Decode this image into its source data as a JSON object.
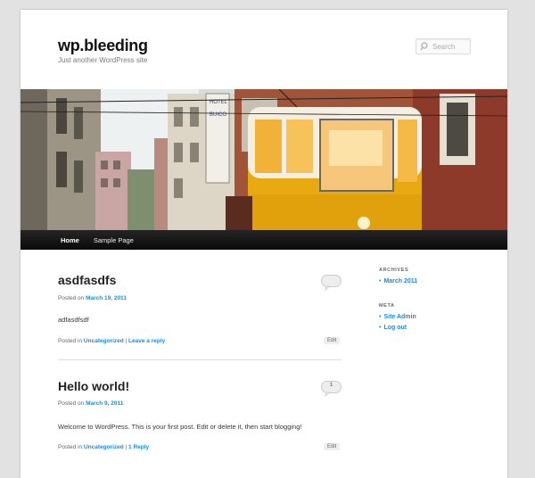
{
  "site": {
    "title": "wp.bleeding",
    "description": "Just another WordPress site"
  },
  "search": {
    "placeholder": "Search",
    "icon": "search-icon"
  },
  "nav": {
    "items": [
      {
        "label": "Home",
        "current": true
      },
      {
        "label": "Sample Page",
        "current": false
      }
    ]
  },
  "posts": [
    {
      "title": "asdfasdfs",
      "posted_on_prefix": "Posted on",
      "date": "March 19, 2011",
      "content": "adfasdfsdf",
      "posted_in_prefix": "Posted in",
      "category": "Uncategorized",
      "comment_link": "Leave a reply",
      "comment_count": "",
      "edit_label": "Edit"
    },
    {
      "title": "Hello world!",
      "posted_on_prefix": "Posted on",
      "date": "March 9, 2011",
      "content": "Welcome to WordPress. This is your first post. Edit or delete it, then start blogging!",
      "posted_in_prefix": "Posted in",
      "category": "Uncategorized",
      "comment_link": "1 Reply",
      "comment_count": "1",
      "edit_label": "Edit"
    }
  ],
  "sidebar": {
    "archives": {
      "title": "ARCHIVES",
      "items": [
        "March 2011"
      ]
    },
    "meta": {
      "title": "META",
      "items": [
        "Site Admin",
        "Log out"
      ]
    }
  },
  "colors": {
    "link": "#1b8be0",
    "nav_bg": "#141414",
    "page_bg": "#e2e2e2",
    "tram_yellow": "#e8aa10"
  }
}
